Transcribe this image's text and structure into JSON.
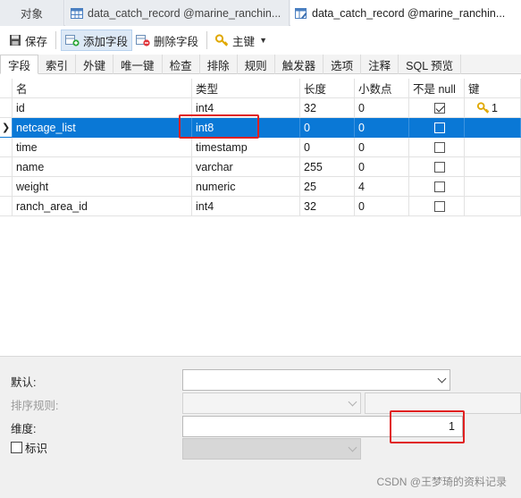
{
  "doc_tabs": [
    {
      "label": "对象"
    },
    {
      "label": "data_catch_record @marine_ranchin..."
    },
    {
      "label": "data_catch_record @marine_ranchin..."
    }
  ],
  "toolbar": {
    "save": "保存",
    "add_field": "添加字段",
    "delete_field": "删除字段",
    "primary_key": "主键"
  },
  "prop_tabs": [
    "字段",
    "索引",
    "外键",
    "唯一键",
    "检查",
    "排除",
    "规则",
    "触发器",
    "选项",
    "注释",
    "SQL 预览"
  ],
  "columns": {
    "name": "名",
    "type": "类型",
    "length": "长度",
    "decimals": "小数点",
    "not_null": "不是 null",
    "key": "键"
  },
  "rows": [
    {
      "name": "id",
      "type": "int4",
      "length": "32",
      "decimals": "0",
      "not_null": true,
      "key": "1",
      "selected": false
    },
    {
      "name": "netcage_list",
      "type": "int8",
      "length": "0",
      "decimals": "0",
      "not_null": false,
      "key": "",
      "selected": true
    },
    {
      "name": "time",
      "type": "timestamp",
      "length": "0",
      "decimals": "0",
      "not_null": false,
      "key": "",
      "selected": false
    },
    {
      "name": "name",
      "type": "varchar",
      "length": "255",
      "decimals": "0",
      "not_null": false,
      "key": "",
      "selected": false
    },
    {
      "name": "weight",
      "type": "numeric",
      "length": "25",
      "decimals": "4",
      "not_null": false,
      "key": "",
      "selected": false
    },
    {
      "name": "ranch_area_id",
      "type": "int4",
      "length": "32",
      "decimals": "0",
      "not_null": false,
      "key": "",
      "selected": false
    }
  ],
  "properties": {
    "default_label": "默认:",
    "default_value": "",
    "collation_label": "排序规则:",
    "dimension_label": "维度:",
    "dimension_value": "1",
    "identity_label": "标识"
  },
  "watermark": "CSDN @王梦琦的资料记录",
  "colors": {
    "selection": "#0a78d6",
    "highlight_box": "#e02020"
  }
}
